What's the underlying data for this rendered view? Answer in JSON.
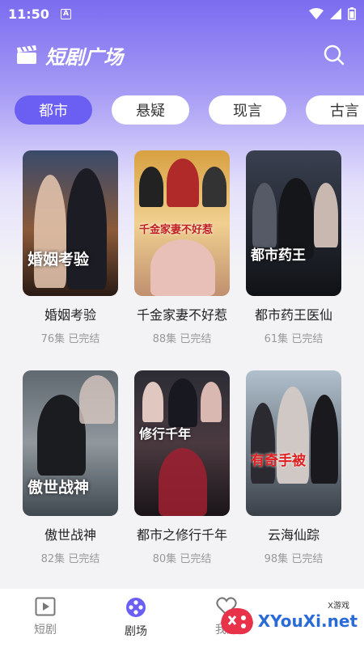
{
  "status_bar": {
    "time": "11:50",
    "notif": "A"
  },
  "header": {
    "title": "短剧广场"
  },
  "tabs": [
    {
      "label": "都市",
      "active": true
    },
    {
      "label": "悬疑",
      "active": false
    },
    {
      "label": "现言",
      "active": false
    },
    {
      "label": "古言",
      "active": false
    }
  ],
  "dramas": [
    {
      "name": "婚姻考验",
      "episodes": "76集",
      "status": "已完结",
      "poster_text": "婚姻考验"
    },
    {
      "name": "千金家妻不好惹",
      "episodes": "88集",
      "status": "已完结",
      "poster_text": "千金家妻不好惹"
    },
    {
      "name": "都市药王医仙",
      "episodes": "61集",
      "status": "已完结",
      "poster_text": "都市药王"
    },
    {
      "name": "傲世战神",
      "episodes": "82集",
      "status": "已完结",
      "poster_text": "傲世战神"
    },
    {
      "name": "都市之修行千年",
      "episodes": "80集",
      "status": "已完结",
      "poster_text": "修行千年"
    },
    {
      "name": "云海仙踪",
      "episodes": "98集",
      "status": "已完结",
      "poster_text": "有奇手被"
    }
  ],
  "bottom_nav": [
    {
      "label": "短剧",
      "icon": "play-icon",
      "active": false
    },
    {
      "label": "剧场",
      "icon": "theater-icon",
      "active": true
    },
    {
      "label": "我的",
      "icon": "heart-icon",
      "active": false
    }
  ],
  "watermark": {
    "text": "XYouXi.net",
    "small": "X游戏"
  },
  "colors": {
    "accent": "#6b5ef2",
    "header_gradient_top": "#7b6cf0"
  }
}
